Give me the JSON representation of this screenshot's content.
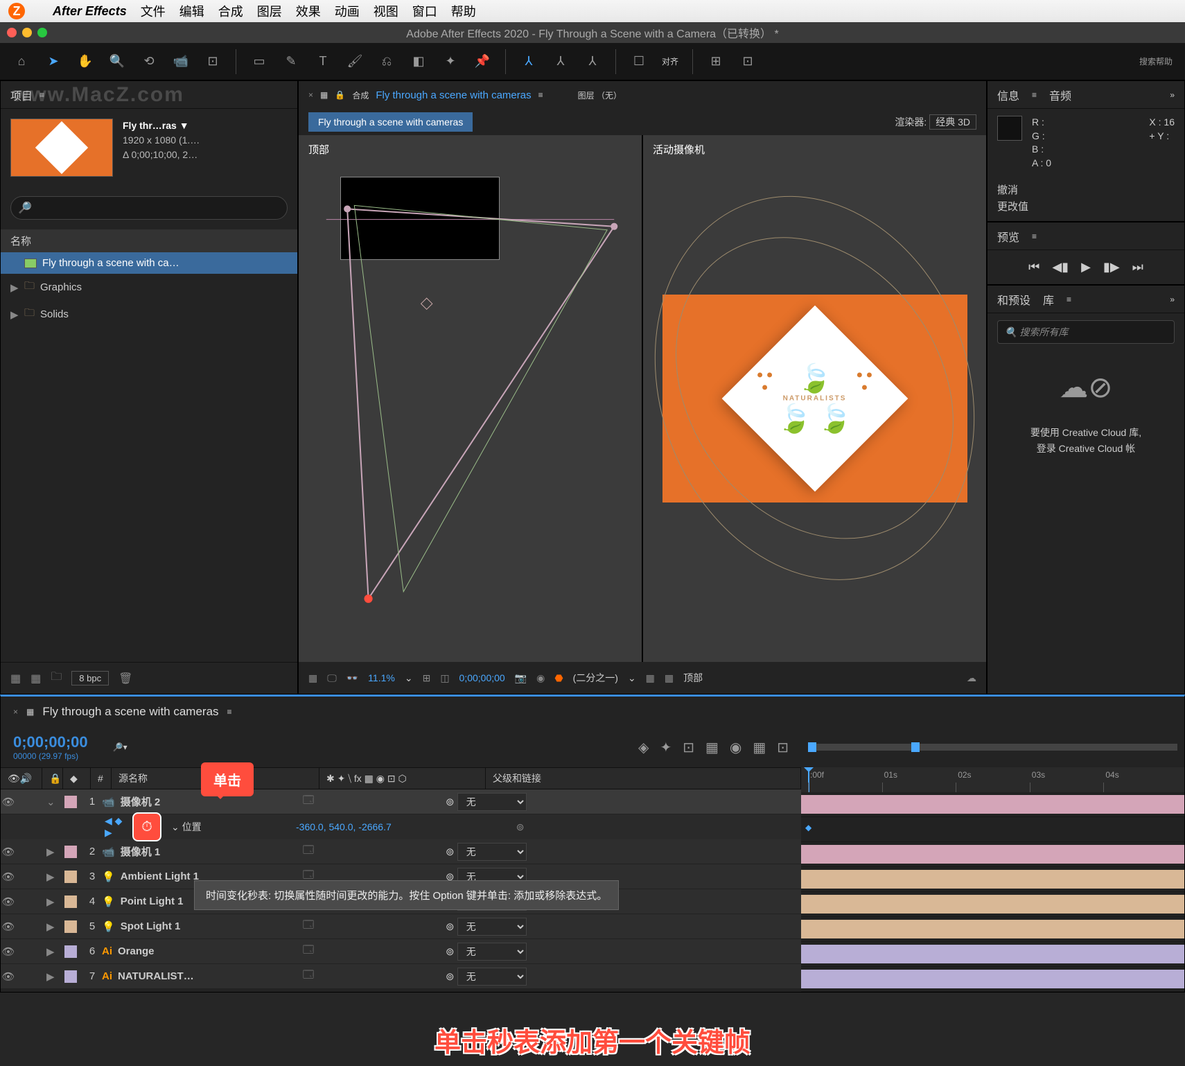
{
  "menubar": {
    "items": [
      "文件",
      "编辑",
      "合成",
      "图层",
      "效果",
      "动画",
      "视图",
      "窗口",
      "帮助"
    ],
    "app": "After Effects"
  },
  "window_title": "Adobe After Effects 2020 - Fly Through a Scene with a Camera（已转换） *",
  "toolbar": {
    "align": "对齐",
    "search": "搜索帮助"
  },
  "project": {
    "title": "项目",
    "comp_name": "Fly thr…ras ▼",
    "comp_res": "1920 x 1080 (1.…",
    "comp_dur": "Δ 0;00;10;00, 2…",
    "search_placeholder": "",
    "col_name": "名称",
    "items": [
      {
        "name": "Fly through a scene with ca…",
        "sel": true,
        "type": "comp"
      },
      {
        "name": "Graphics",
        "type": "folder"
      },
      {
        "name": "Solids",
        "type": "folder"
      }
    ],
    "bpc": "8 bpc"
  },
  "comp": {
    "header_prefix": "合成",
    "header_name": "Fly through a scene with cameras",
    "layer_label": "图层 （无）",
    "tab": "Fly through a scene with cameras",
    "renderer_lbl": "渲染器:",
    "renderer_val": "经典 3D",
    "vp_top": "顶部",
    "vp_active": "活动摄像机",
    "zoom": "11.1%",
    "timecode": "0;00;00;00",
    "res": "(二分之一)",
    "view": "顶部",
    "brand": "NATURALISTS"
  },
  "info": {
    "title": "信息",
    "audio": "音频",
    "r": "R :",
    "g": "G :",
    "b": "B :",
    "a": "A : 0",
    "x": "X : 16",
    "y": "Y :",
    "plus": "+",
    "undo": "撤消",
    "change": "更改值"
  },
  "preview": {
    "title": "预览"
  },
  "lib": {
    "presets": "和预设",
    "title": "库",
    "search_placeholder": "搜索所有库",
    "msg1": "要使用 Creative Cloud 库,",
    "msg2": "登录 Creative Cloud 帐"
  },
  "timeline": {
    "title": "Fly through a scene with cameras",
    "timecode": "0;00;00;00",
    "fps": "00000 (29.97 fps)",
    "col_source": "源名称",
    "col_parent": "父级和链接",
    "ruler": [
      ":00f",
      "01s",
      "02s",
      "03s",
      "04s"
    ],
    "layers": [
      {
        "num": "1",
        "name": "摄像机 2",
        "color": "#d4a5b8",
        "icon": "camera",
        "parent": "无",
        "sel": true
      },
      {
        "prop": true,
        "name": "位置",
        "val": "-360.0, 540.0, -2666.7"
      },
      {
        "num": "2",
        "name": "摄像机 1",
        "color": "#d4a5b8",
        "icon": "camera",
        "parent": "无"
      },
      {
        "num": "3",
        "name": "Ambient Light 1",
        "color": "#d9b896",
        "icon": "light",
        "parent": "无"
      },
      {
        "num": "4",
        "name": "Point Light 1",
        "color": "#d9b896",
        "icon": "light",
        "parent": "无"
      },
      {
        "num": "5",
        "name": "Spot Light 1",
        "color": "#d9b896",
        "icon": "light",
        "parent": "无"
      },
      {
        "num": "6",
        "name": "Orange",
        "color": "#b8aed6",
        "icon": "ai",
        "parent": "无"
      },
      {
        "num": "7",
        "name": "NATURALIST…",
        "color": "#b8aed6",
        "icon": "ai",
        "parent": "无"
      }
    ]
  },
  "callout1": "单击",
  "tooltip": "时间变化秒表: 切换属性随时间更改的能力。按住 Option 键并单击: 添加或移除表达式。",
  "caption": "单击秒表添加第一个关键帧",
  "watermark": "www.MacZ.com"
}
